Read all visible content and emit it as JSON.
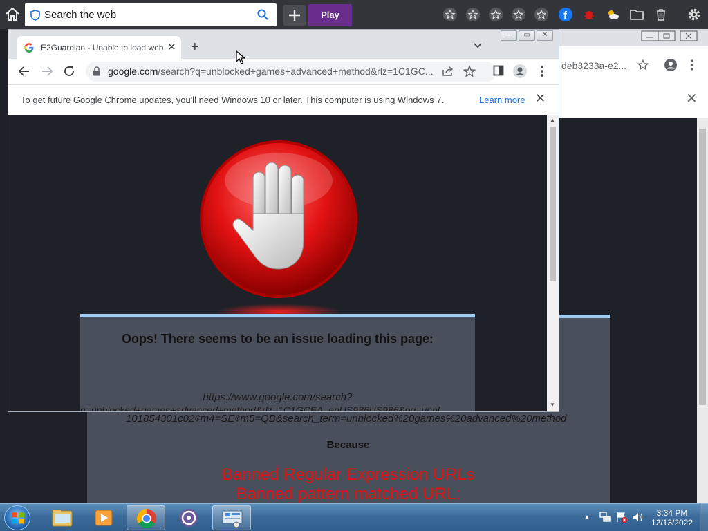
{
  "topbar": {
    "search_placeholder": "Search the web",
    "play_label": "Play",
    "icons": [
      "home-icon",
      "shield-icon",
      "search-icon",
      "plus-icon",
      "star-icon",
      "star-icon",
      "star-icon",
      "star-icon",
      "star-icon",
      "facebook-icon",
      "bug-icon",
      "weather-icon",
      "folder-icon",
      "trash-icon",
      "gear-icon"
    ]
  },
  "bg_browser": {
    "url_fragment": "deb3233a-e2..."
  },
  "chrome": {
    "tab_title": "E2Guardian - Unable to load web",
    "address_host": "google.com",
    "address_path": "/search?q=unblocked+games+advanced+method&rlz=1C1GC...",
    "infobar_message": "To get future Google Chrome updates, you'll need Windows 10 or later. This computer is using Windows 7.",
    "infobar_link": "Learn more"
  },
  "page": {
    "heading": "Oops! There seems to be an issue loading this page:",
    "url_line1": "https://www.google.com/search?",
    "url_line2": "q=unblocked+games+advanced+method&rlz=1C1GCEA_enUS986US986&oq=unbl",
    "url_line3": "101854301c02¢m4=SE¢m5=QB&search_term=unblocked%20games%20advanced%20method",
    "because": "Because",
    "reason1": "Banned Regular Expression URLs",
    "reason2": "Banned pattern matched URL:"
  },
  "taskbar": {
    "apps": [
      "windows-explorer",
      "media-player",
      "google-chrome",
      "app-circle",
      "remote-desktop"
    ],
    "time": "3:34 PM",
    "date": "12/13/2022"
  },
  "colors": {
    "play_purple": "#6a2e8e",
    "stop_red": "#e01414",
    "link_blue": "#1a73e8",
    "panel_gray": "#4a4f5c",
    "page_bg": "#1f2128"
  }
}
